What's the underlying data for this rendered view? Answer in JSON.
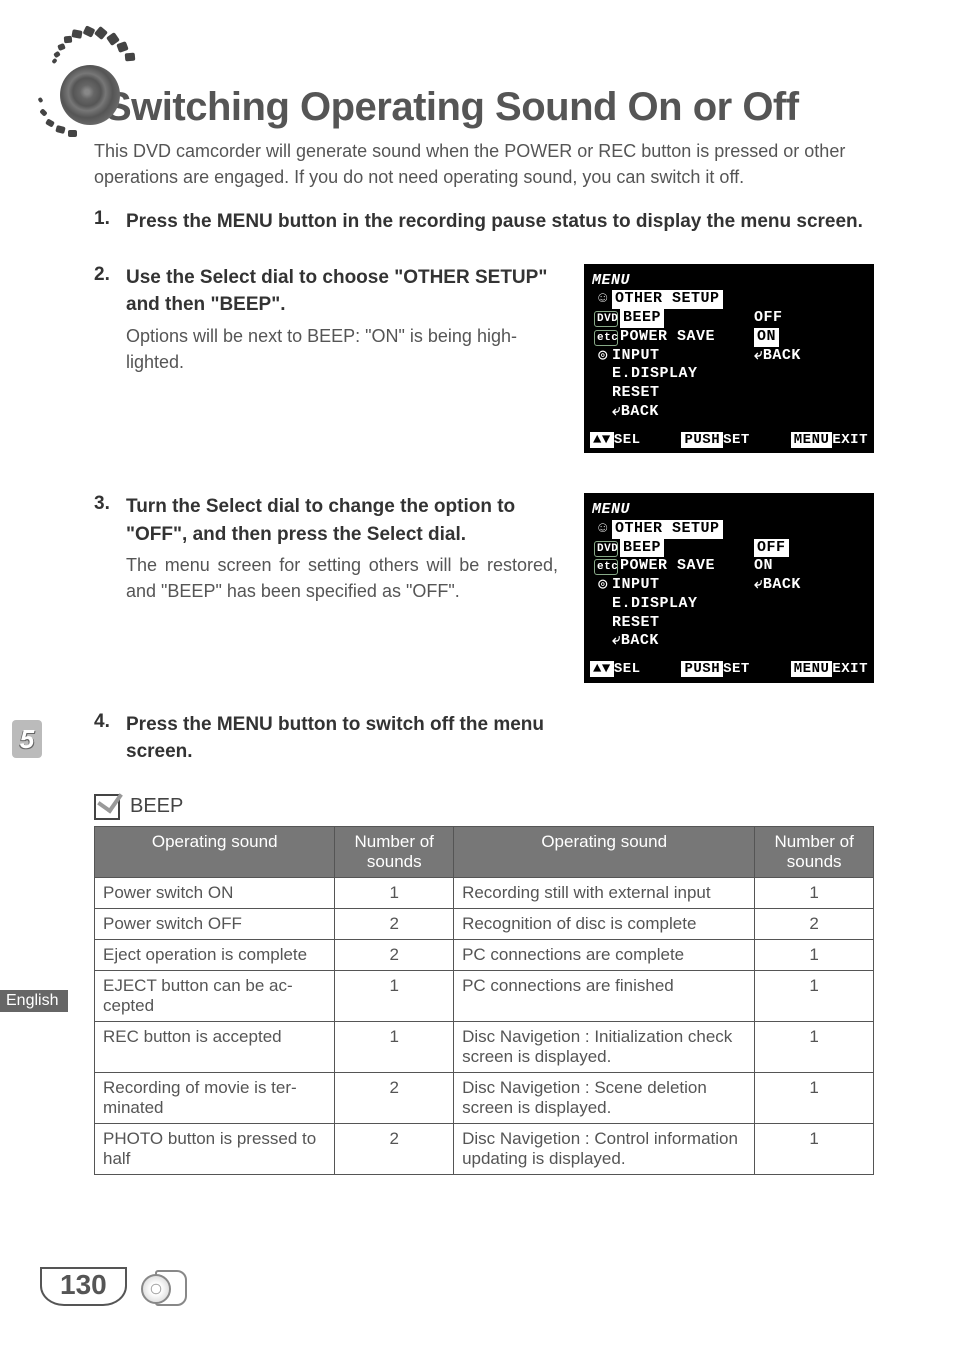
{
  "title": "Switching Operating Sound On or Off",
  "intro": "This DVD camcorder will generate sound when the POWER or REC button is pressed or other operations are engaged. If you do not need operating sound, you can switch it off.",
  "steps": [
    {
      "cmd": "Press the MENU button in the recording pause status to display the menu screen."
    },
    {
      "cmd": "Use the Select dial to choose \"OTHER SETUP\" and then \"BEEP\".",
      "desc": "Options will be next to BEEP: \"ON\" is being high­lighted.",
      "lcd": {
        "header": "MENU",
        "left_selected": "OTHER SETUP",
        "left": [
          "BEEP",
          "POWER SAVE",
          "INPUT",
          "E.DISPLAY",
          "RESET",
          "⤶BACK"
        ],
        "right": [
          "OFF",
          "ON",
          "⤶BACK"
        ],
        "right_selected_idx": 1,
        "footer": {
          "sel": "SEL",
          "push": "PUSH",
          "set": "SET",
          "menu": "MENU",
          "exit": "EXIT"
        }
      }
    },
    {
      "cmd": "Turn the Select dial to change the option to \"OFF\", and then press the Select dial.",
      "desc": "The menu screen for setting others will be re­stored, and \"BEEP\" has been specified as \"OFF\".",
      "lcd": {
        "header": "MENU",
        "left_selected": "OTHER SETUP",
        "left": [
          "BEEP",
          "POWER SAVE",
          "INPUT",
          "E.DISPLAY",
          "RESET",
          "⤶BACK"
        ],
        "right": [
          "OFF",
          "ON",
          "⤶BACK"
        ],
        "right_selected_idx": 0,
        "footer": {
          "sel": "SEL",
          "push": "PUSH",
          "set": "SET",
          "menu": "MENU",
          "exit": "EXIT"
        }
      }
    },
    {
      "cmd": "Press the MENU button to switch off the menu screen."
    }
  ],
  "beep_heading": "BEEP",
  "table": {
    "headers": {
      "op": "Operating sound",
      "num": "Number of sounds"
    },
    "left": [
      {
        "op": "Power switch ON",
        "num": "1"
      },
      {
        "op": "Power switch OFF",
        "num": "2"
      },
      {
        "op": "Eject operation is complete",
        "num": "2"
      },
      {
        "op": "EJECT button can be ac­cepted",
        "num": "1"
      },
      {
        "op": "REC button is accepted",
        "num": "1"
      },
      {
        "op": "Recording of movie is ter­minated",
        "num": "2"
      },
      {
        "op": "PHOTO button is pressed to half",
        "num": "2"
      }
    ],
    "right": [
      {
        "op": "Recording still with external in­put",
        "num": "1"
      },
      {
        "op": "Recognition of disc is complete",
        "num": "2"
      },
      {
        "op": "PC connections are complete",
        "num": "1"
      },
      {
        "op": "PC connections are finished",
        "num": "1"
      },
      {
        "op": "Disc Navigetion : Initialization check screen is displayed.",
        "num": "1"
      },
      {
        "op": "Disc Navigetion : Scene deletion screen is displayed.",
        "num": "1"
      },
      {
        "op": "Disc Navigetion : Control infor­mation updating is displayed.",
        "num": "1"
      }
    ]
  },
  "side": {
    "section_num": "5",
    "lang": "English"
  },
  "page_no": "130"
}
